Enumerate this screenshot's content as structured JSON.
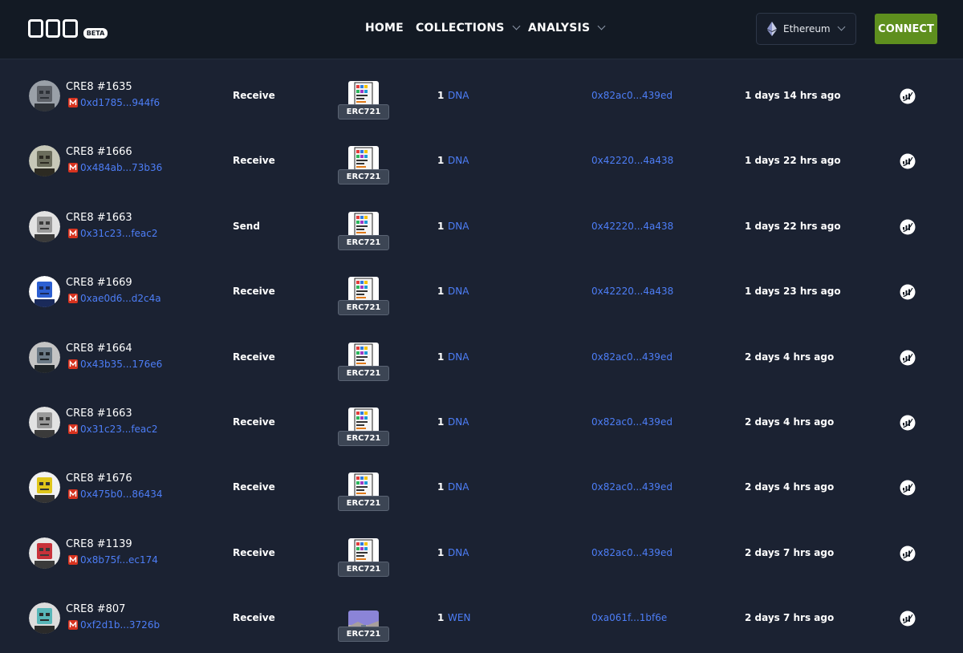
{
  "header": {
    "beta": "BETA",
    "nav": [
      {
        "label": "HOME",
        "dropdown": false
      },
      {
        "label": "COLLECTIONS",
        "dropdown": true
      },
      {
        "label": "ANALYSIS",
        "dropdown": true
      }
    ],
    "network": "Ethereum",
    "connect": "CONNECT"
  },
  "colors": {
    "background": "#1b2232",
    "header_bg": "#131a24",
    "link": "#4d7ef7",
    "connect_button": "#5e8f1e",
    "badge_bg": "#3c4554"
  },
  "rows": [
    {
      "token": "CRE8 #1635",
      "owner": "0xd1785...944f6",
      "action": "Receive",
      "standard": "ERC721",
      "qty": "1",
      "collection": "DNA",
      "to": "0x82ac0...439ed",
      "time": "1 days 14 hrs ago",
      "avatar": "robot-grey-avatar",
      "thumb": "dna-card"
    },
    {
      "token": "CRE8 #1666",
      "owner": "0x484ab...73b36",
      "action": "Receive",
      "standard": "ERC721",
      "qty": "1",
      "collection": "DNA",
      "to": "0x42220...4a438",
      "time": "1 days 22 hrs ago",
      "avatar": "robot-hat-avatar",
      "thumb": "dna-card"
    },
    {
      "token": "CRE8 #1663",
      "owner": "0x31c23...feac2",
      "action": "Send",
      "standard": "ERC721",
      "qty": "1",
      "collection": "DNA",
      "to": "0x42220...4a438",
      "time": "1 days 22 hrs ago",
      "avatar": "robot-white-avatar",
      "thumb": "dna-card"
    },
    {
      "token": "CRE8 #1669",
      "owner": "0xae0d6...d2c4a",
      "action": "Receive",
      "standard": "ERC721",
      "qty": "1",
      "collection": "DNA",
      "to": "0x42220...4a438",
      "time": "1 days 23 hrs ago",
      "avatar": "robot-blue-avatar",
      "thumb": "dna-card"
    },
    {
      "token": "CRE8 #1664",
      "owner": "0x43b35...176e6",
      "action": "Receive",
      "standard": "ERC721",
      "qty": "1",
      "collection": "DNA",
      "to": "0x82ac0...439ed",
      "time": "2 days 4 hrs ago",
      "avatar": "robot-dark-avatar",
      "thumb": "dna-card"
    },
    {
      "token": "CRE8 #1663",
      "owner": "0x31c23...feac2",
      "action": "Receive",
      "standard": "ERC721",
      "qty": "1",
      "collection": "DNA",
      "to": "0x82ac0...439ed",
      "time": "2 days 4 hrs ago",
      "avatar": "robot-white-avatar",
      "thumb": "dna-card"
    },
    {
      "token": "CRE8 #1676",
      "owner": "0x475b0...86434",
      "action": "Receive",
      "standard": "ERC721",
      "qty": "1",
      "collection": "DNA",
      "to": "0x82ac0...439ed",
      "time": "2 days 4 hrs ago",
      "avatar": "robot-yellow-avatar",
      "thumb": "dna-card"
    },
    {
      "token": "CRE8 #1139",
      "owner": "0x8b75f...ec174",
      "action": "Receive",
      "standard": "ERC721",
      "qty": "1",
      "collection": "DNA",
      "to": "0x82ac0...439ed",
      "time": "2 days 7 hrs ago",
      "avatar": "robot-red-avatar",
      "thumb": "dna-card"
    },
    {
      "token": "CRE8 #807",
      "owner": "0xf2d1b...3726b",
      "action": "Receive",
      "standard": "ERC721",
      "qty": "1",
      "collection": "WEN",
      "to": "0xa061f...1bf6e",
      "time": "2 days 7 hrs ago",
      "avatar": "robot-teal-avatar",
      "thumb": "landscape"
    }
  ]
}
